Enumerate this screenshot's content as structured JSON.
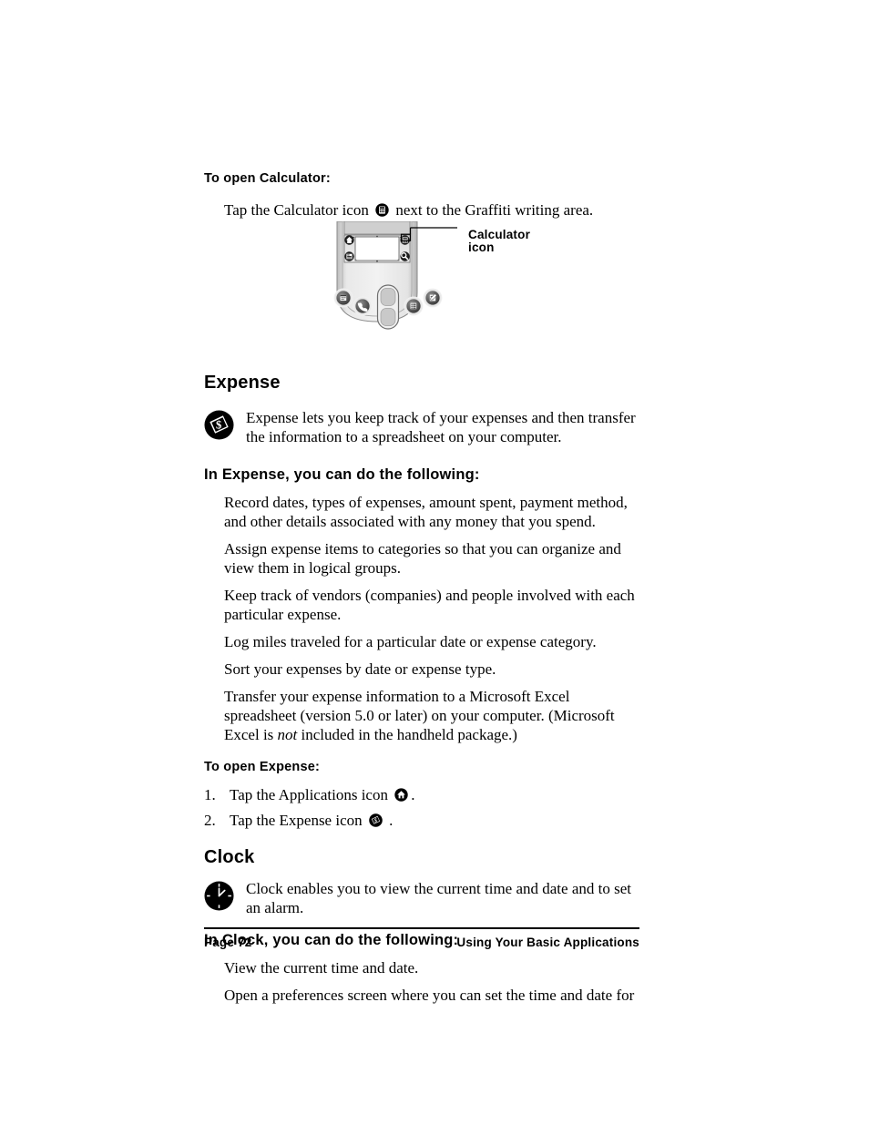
{
  "document": {
    "page_number_label": "Page 72",
    "running_footer": "Using Your Basic Applications"
  },
  "sections": {
    "to_open_calculator": {
      "heading": "To open Calculator:",
      "instruction_before_icon": "Tap the Calculator icon",
      "icon_name": "calculator-icon",
      "instruction_after_icon": "next to the Graffiti writing area."
    },
    "figure": {
      "callout_line1": "Calculator",
      "callout_line2": "icon",
      "device_icons": {
        "applications": "applications-home-icon",
        "calculator": "calculator-icon",
        "menu": "menu-icon",
        "find": "find-icon"
      },
      "hardware_buttons": [
        "date-book-button",
        "address-button",
        "to-do-list-button",
        "memo-pad-button"
      ],
      "scroll_control": "scroll-rocker"
    },
    "expense": {
      "heading": "Expense",
      "icon_name": "expense-coin-icon",
      "description": "Expense lets you keep track of your expenses and then transfer the information to a spreadsheet on your computer.",
      "subheading": "In Expense, you can do the following:",
      "bullets": [
        "Record dates, types of expenses, amount spent, payment method, and other details associated with any money that you spend.",
        "Assign expense items to categories so that you can organize and view them in logical groups.",
        "Keep track of vendors (companies) and people involved with each particular expense.",
        "Log miles traveled for a particular date or expense category.",
        "Sort your expenses by date or expense type."
      ],
      "excel_bullet": {
        "part1": "Transfer your expense information to a Microsoft Excel spreadsheet (version 5.0 or later) on your computer. (Microsoft Excel is ",
        "emphasis": "not",
        "part2": " included in the handheld package.)"
      },
      "to_open_heading": "To open Expense:",
      "steps": [
        {
          "number": "1.",
          "text_before_icon": "Tap the Applications icon",
          "icon_name": "applications-home-icon",
          "text_after_icon": "."
        },
        {
          "number": "2.",
          "text_before_icon": "Tap the Expense icon",
          "icon_name": "expense-coin-icon",
          "text_after_icon": "."
        }
      ]
    },
    "clock": {
      "heading": "Clock",
      "icon_name": "clock-icon",
      "description": "Clock enables you to view the current time and date and to set an alarm.",
      "subheading": "In Clock, you can do the following:",
      "bullets": [
        "View the current time and date.",
        "Open a preferences screen where you can set the time and date for"
      ]
    }
  },
  "colors": {
    "text": "#000000",
    "page_background": "#ffffff",
    "device_body_light": "#e8e8e8",
    "device_body_mid": "#d0d0d0",
    "device_body_dark": "#9a9a9a",
    "device_screen": "#ffffff",
    "button_dark": "#555555"
  }
}
